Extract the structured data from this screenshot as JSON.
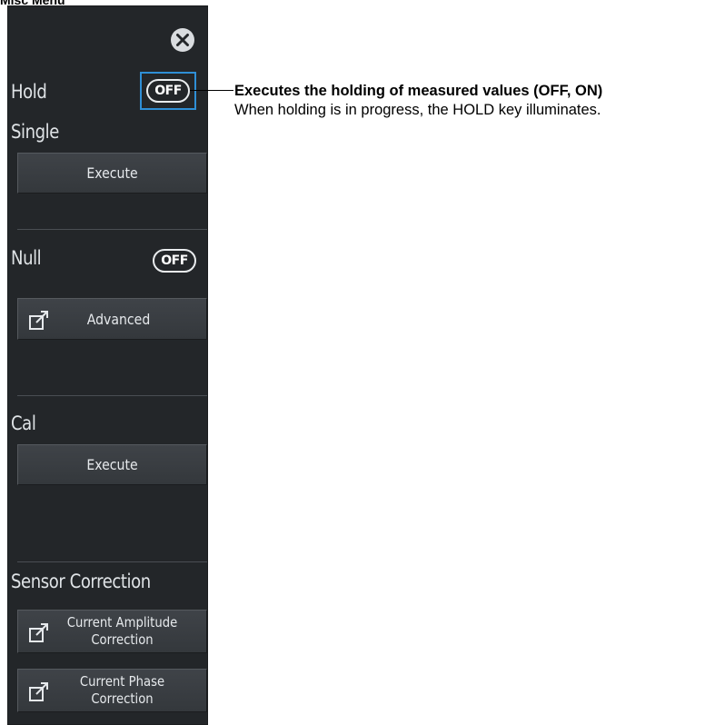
{
  "menu_heading": "Misc Menu",
  "panel": {
    "close_icon": "close-icon",
    "hold": {
      "label": "Hold",
      "toggle": "OFF"
    },
    "single": {
      "label": "Single",
      "button": "Execute"
    },
    "null": {
      "label": "Null",
      "toggle": "OFF",
      "button": "Advanced",
      "button_icon": "open-dialog-icon"
    },
    "cal": {
      "label": "Cal",
      "button": "Execute"
    },
    "sensor_correction": {
      "label": "Sensor Correction",
      "amplitude_line1": "Current Amplitude",
      "amplitude_line2": "Correction",
      "phase_line1": "Current Phase",
      "phase_line2": "Correction",
      "button_icon": "open-dialog-icon"
    }
  },
  "callout": {
    "title": "Executes the holding of measured values (OFF, ON)",
    "description": "When holding is in progress, the HOLD key illuminates."
  },
  "colors": {
    "panel_bg": "#232629",
    "button_bg": "#3a3e42",
    "highlight": "#2f8fd6",
    "text": "#dfe3e6"
  }
}
